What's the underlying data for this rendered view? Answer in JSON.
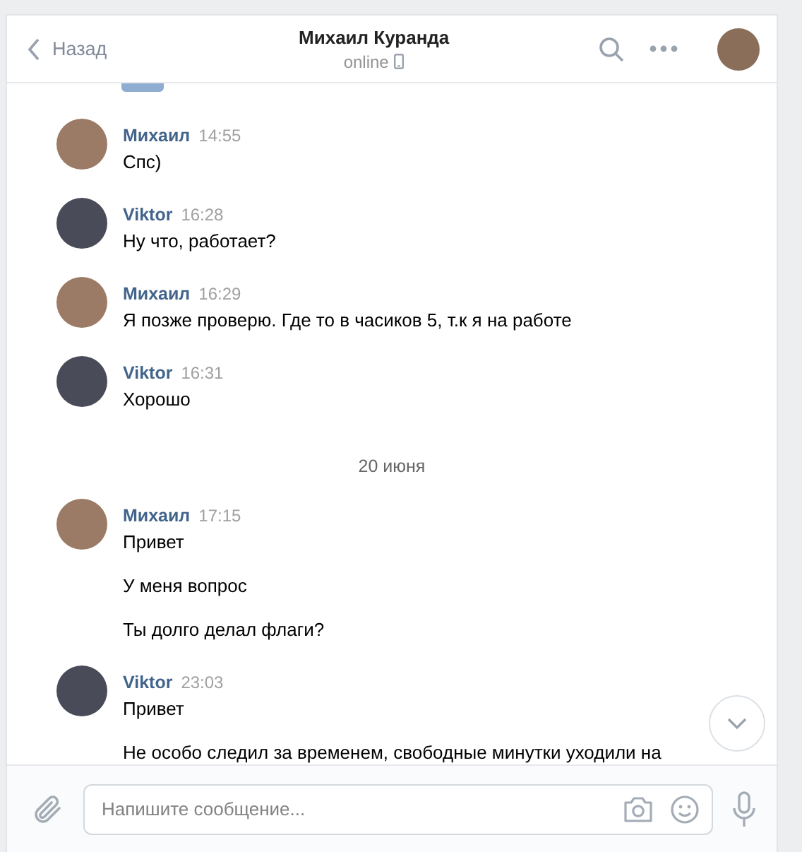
{
  "header": {
    "back_label": "Назад",
    "title": "Михаил Куранда",
    "status": "online"
  },
  "messages": [
    {
      "kind": "message",
      "author": "Михаил",
      "time": "14:55",
      "paragraphs": [
        "Спс)"
      ]
    },
    {
      "kind": "message",
      "author": "Viktor",
      "time": "16:28",
      "paragraphs": [
        "Ну что, работает?"
      ]
    },
    {
      "kind": "message",
      "author": "Михаил",
      "time": "16:29",
      "paragraphs": [
        "Я позже проверю. Где то в часиков 5, т.к я на работе"
      ]
    },
    {
      "kind": "message",
      "author": "Viktor",
      "time": "16:31",
      "paragraphs": [
        "Хорошо"
      ]
    },
    {
      "kind": "date",
      "text": "20 июня"
    },
    {
      "kind": "message",
      "author": "Михаил",
      "time": "17:15",
      "paragraphs": [
        "Привет",
        "У меня вопрос",
        "Ты долго делал флаги?"
      ]
    },
    {
      "kind": "message",
      "author": "Viktor",
      "time": "23:03",
      "paragraphs": [
        "Привет",
        "Не особо следил за временем, свободные минутки уходили на"
      ]
    }
  ],
  "composer": {
    "placeholder": "Напишите сообщение..."
  }
}
